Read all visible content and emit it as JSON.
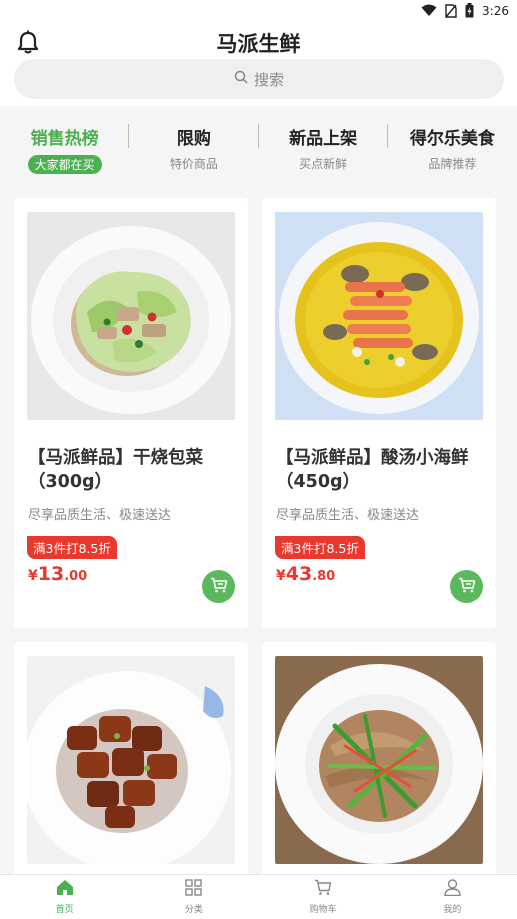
{
  "status_bar": {
    "time": "3:26"
  },
  "header": {
    "title": "马派生鲜",
    "search_placeholder": "搜索"
  },
  "tabs": [
    {
      "title": "销售热榜",
      "subtitle": "大家都在买",
      "active": true
    },
    {
      "title": "限购",
      "subtitle": "特价商品",
      "active": false
    },
    {
      "title": "新品上架",
      "subtitle": "买点新鲜",
      "active": false
    },
    {
      "title": "得尔乐美食",
      "subtitle": "品牌推荐",
      "active": false
    }
  ],
  "products": [
    {
      "name": "【马派鲜品】干烧包菜（300g）",
      "desc": "尽享品质生活、极速送达",
      "promo": "满3件打8.5折",
      "currency": "¥",
      "price_int": "13",
      "price_dec": ".00",
      "image": "stir-fried-cabbage"
    },
    {
      "name": "【马派鲜品】酸汤小海鲜（450g）",
      "desc": "尽享品质生活、极速送达",
      "promo": "满3件打8.5折",
      "currency": "¥",
      "price_int": "43",
      "price_dec": ".80",
      "image": "sour-soup-seafood"
    },
    {
      "image": "braised-pork"
    },
    {
      "image": "stir-fried-noodles"
    }
  ],
  "bottom_nav": [
    {
      "label": "首页",
      "icon": "home-icon",
      "active": true
    },
    {
      "label": "分类",
      "icon": "grid-icon",
      "active": false
    },
    {
      "label": "购物车",
      "icon": "cart-icon",
      "active": false
    },
    {
      "label": "我的",
      "icon": "user-icon",
      "active": false
    }
  ],
  "colors": {
    "accent": "#4caf50",
    "price": "#e8392d",
    "cart_button": "#5cb85c"
  }
}
